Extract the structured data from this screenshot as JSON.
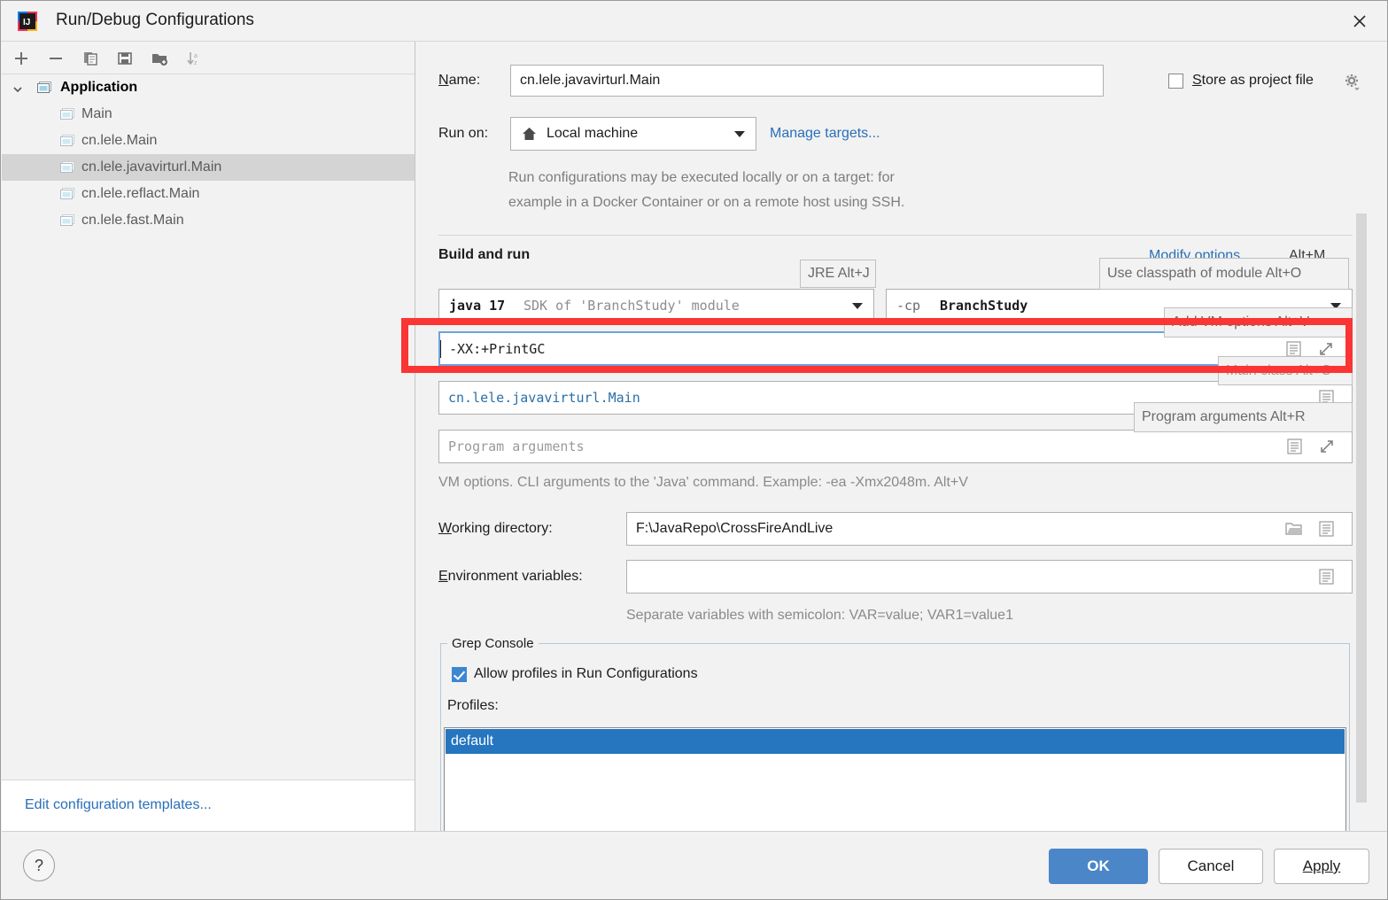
{
  "window": {
    "title": "Run/Debug Configurations",
    "app_icon": "intellij-idea-icon",
    "close_icon": "close-icon"
  },
  "toolbar": {
    "buttons": [
      {
        "name": "add-configuration-button",
        "icon": "plus-icon"
      },
      {
        "name": "remove-configuration-button",
        "icon": "minus-icon"
      },
      {
        "name": "copy-configuration-button",
        "icon": "copy-icon"
      },
      {
        "name": "save-configuration-button",
        "icon": "save-icon"
      },
      {
        "name": "new-folder-button",
        "icon": "folder-add-icon"
      },
      {
        "name": "sort-configurations-button",
        "icon": "sort-alpha-icon"
      }
    ]
  },
  "sidebar": {
    "items": [
      {
        "label": "Application",
        "root": true,
        "selected": false
      },
      {
        "label": "Main",
        "root": false,
        "selected": false
      },
      {
        "label": "cn.lele.Main",
        "root": false,
        "selected": false
      },
      {
        "label": "cn.lele.javavirturl.Main",
        "root": false,
        "selected": true
      },
      {
        "label": "cn.lele.reflact.Main",
        "root": false,
        "selected": false
      },
      {
        "label": "cn.lele.fast.Main",
        "root": false,
        "selected": false
      }
    ],
    "edit_templates_link": "Edit configuration templates..."
  },
  "form": {
    "name_label": "Name:",
    "name_label_mnemonic": "N",
    "name_value": "cn.lele.javavirturl.Main",
    "store_as_project_file_label": "Store as project file",
    "store_as_project_file_checked": false,
    "store_gear_icon": "gear-icon",
    "run_on_label": "Run on:",
    "run_on_value": "Local machine",
    "run_on_icon": "home-icon",
    "manage_targets_link": "Manage targets...",
    "run_on_description_line1": "Run configurations may be executed locally or on a target: for",
    "run_on_description_line2": "example in a Docker Container or on a remote host using SSH.",
    "build_and_run_title": "Build and run",
    "modify_options_link": "Modify options",
    "modify_options_shortcut": "Alt+M",
    "jre_tooltip": "JRE Alt+J",
    "jre_tooltip_key": "J",
    "jre_value_bold": "java 17",
    "jre_value_gray": "SDK of 'BranchStudy' module",
    "classpath_tooltip": "Use classpath of module Alt+O",
    "classpath_tooltip_key": "O",
    "classpath_prefix": "-cp",
    "classpath_value": "BranchStudy",
    "vm_options_tooltip": "Add VM options Alt+V",
    "vm_options_tooltip_key": "V",
    "vm_options_value": "-XX:+PrintGC",
    "main_class_tooltip": "Main class Alt+C",
    "main_class_tooltip_key": "C",
    "main_class_value": "cn.lele.javavirturl.Main",
    "program_arguments_tooltip": "Program arguments Alt+R",
    "program_arguments_tooltip_key": "R",
    "program_arguments_placeholder": "Program arguments",
    "vm_options_hint": "VM options. CLI arguments to the 'Java' command. Example: -ea -Xmx2048m. Alt+V",
    "working_directory_label": "Working directory:",
    "working_directory_mnemonic": "W",
    "working_directory_value": "F:\\JavaRepo\\CrossFireAndLive",
    "working_directory_browse_icon": "folder-icon",
    "working_directory_history_icon": "list-icon",
    "environment_variables_label": "Environment variables:",
    "environment_variables_mnemonic": "E",
    "environment_variables_value": "",
    "environment_variables_edit_icon": "list-icon",
    "environment_variables_hint": "Separate variables with semicolon: VAR=value; VAR1=value1"
  },
  "grep_console": {
    "group_title": "Grep Console",
    "allow_profiles_label": "Allow profiles in Run Configurations",
    "allow_profiles_checked": true,
    "profiles_label": "Profiles:",
    "profiles": [
      "default"
    ],
    "selected_profile": "default"
  },
  "footer": {
    "help_label": "?",
    "ok_label": "OK",
    "cancel_label": "Cancel",
    "apply_label": "Apply",
    "apply_mnemonic": "A"
  },
  "annotation": {
    "highlight_color": "#fb3434",
    "highlight_target": "vm-options-field"
  },
  "colors": {
    "accent_blue": "#2a6fb8",
    "primary_button": "#4a86c8",
    "selection_blue": "#2675bf",
    "tree_selected": "#d4d4d4",
    "background": "#f2f2f2"
  }
}
